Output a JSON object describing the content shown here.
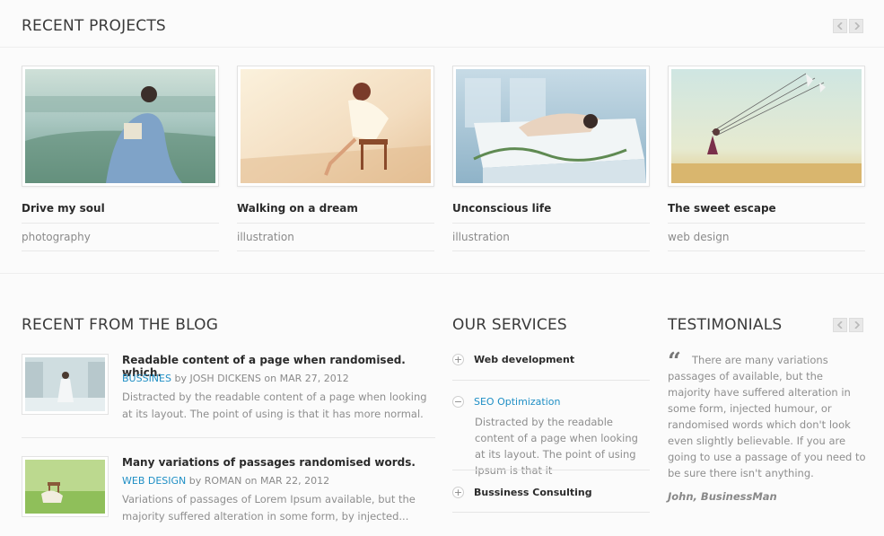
{
  "recent_projects": {
    "title": "RECENT PROJECTS",
    "items": [
      {
        "title": "Drive my soul",
        "category": "photography"
      },
      {
        "title": "Walking on a dream",
        "category": "illustration"
      },
      {
        "title": "Unconscious life",
        "category": "illustration"
      },
      {
        "title": "The sweet escape",
        "category": "web design"
      }
    ]
  },
  "blog": {
    "title": "RECENT FROM THE BLOG",
    "posts": [
      {
        "title": "Readable content of a page when randomised. which.",
        "category": "BUSSINES",
        "by": "by",
        "author": "JOSH DICKENS",
        "on": "on",
        "date": "MAR 27, 2012",
        "excerpt": "Distracted by the readable content of a page when looking at its layout. The point of using is that it has more normal."
      },
      {
        "title": "Many variations of passages randomised words.",
        "category": "WEB DESIGN",
        "by": "by",
        "author": "ROMAN",
        "on": "on",
        "date": "MAR 22, 2012",
        "excerpt": "Variations of passages of Lorem Ipsum available, but the majority suffered alteration in some form, by injected..."
      }
    ]
  },
  "services": {
    "title": "OUR SERVICES",
    "items": [
      {
        "label": "Web development",
        "icon": "+"
      },
      {
        "label": "SEO Optimization",
        "icon": "−",
        "body": "Distracted by the readable content of a page when looking at its layout. The point of using Ipsum is that it"
      },
      {
        "label": "Bussiness Consulting",
        "icon": "+"
      }
    ]
  },
  "testimonials": {
    "title": "TESTIMONIALS",
    "quote_mark": "“",
    "quote": "There are many variations passages of available, but the majority have suffered alteration in some form, injected humour, or randomised words which don't look even slightly believable. If you are going to use a passage of you need to be sure there isn't anything.",
    "author": "John, BusinessMan"
  },
  "colors": {
    "accent": "#1f8fc5",
    "background": "#fbfbfb"
  }
}
